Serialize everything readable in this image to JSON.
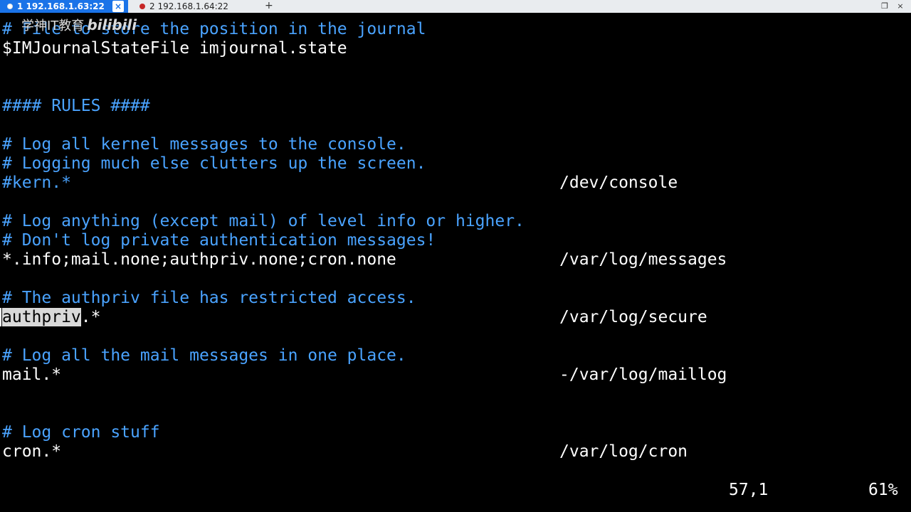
{
  "tabs": [
    {
      "label": "1 192.168.1.63:22",
      "active": true,
      "close": "×"
    },
    {
      "label": "2 192.168.1.64:22",
      "active": false,
      "close": "×"
    }
  ],
  "new_tab": "+",
  "window_controls": {
    "restore": "❐",
    "close": "×"
  },
  "watermark": {
    "text": "学神IT教育",
    "brand": "bilibili"
  },
  "terminal": {
    "lines": [
      {
        "text": "# File to store the position in the journal",
        "kind": "comment"
      },
      {
        "text": "$IMJournalStateFile imjournal.state",
        "kind": "text"
      },
      {
        "text": "#### RULES ####",
        "kind": "comment"
      },
      {
        "text": "# Log all kernel messages to the console.",
        "kind": "comment"
      },
      {
        "text": "# Logging much else clutters up the screen.",
        "kind": "comment"
      },
      {
        "text": "#kern.*",
        "kind": "comment",
        "dest": "/dev/console"
      },
      {
        "text": "# Log anything (except mail) of level info or higher.",
        "kind": "comment"
      },
      {
        "text": "# Don't log private authentication messages!",
        "kind": "comment"
      },
      {
        "text": "*.info;mail.none;authpriv.none;cron.none",
        "kind": "text",
        "dest": "/var/log/messages"
      },
      {
        "text": "# The authpriv file has restricted access.",
        "kind": "comment"
      },
      {
        "selected": "authpriv",
        "rest": ".*",
        "kind": "text",
        "dest": "/var/log/secure"
      },
      {
        "text": "# Log all the mail messages in one place.",
        "kind": "comment"
      },
      {
        "text": "mail.*",
        "kind": "text",
        "dest": "-/var/log/maillog"
      },
      {
        "text": "# Log cron stuff",
        "kind": "comment"
      },
      {
        "text": "cron.*",
        "kind": "text",
        "dest": "/var/log/cron"
      }
    ],
    "status": {
      "position": "57,1",
      "percent": "61%"
    }
  },
  "colors": {
    "comment": "#4aa3ff",
    "text": "#ffffff",
    "background": "#000000",
    "active_tab": "#1a73e8"
  }
}
